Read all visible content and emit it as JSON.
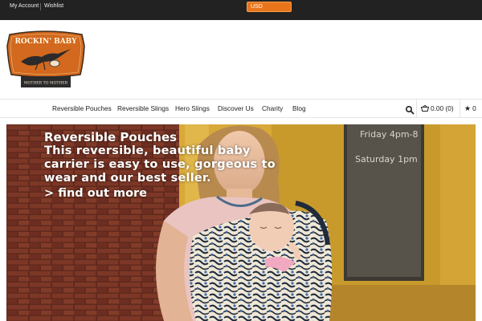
{
  "topbar": {
    "my_account": "My Account",
    "wishlist": "Wishlist",
    "currency": "USD"
  },
  "logo": {
    "text_top": "ROCKIN' BABY",
    "text_bottom": "MOTHER TO MOTHER",
    "colors": {
      "orange": "#d2691e",
      "dark": "#2b2b2b"
    }
  },
  "nav": {
    "items": [
      {
        "label": "Reversible Pouches"
      },
      {
        "label": "Reversible Slings"
      },
      {
        "label": "Hero Slings"
      },
      {
        "label": "Discover Us"
      },
      {
        "label": "Charity"
      },
      {
        "label": "Blog"
      }
    ],
    "cart_total": "0.00",
    "cart_count": "(0)",
    "wishlist_count": "0"
  },
  "hero": {
    "title": "Reversible Pouches",
    "description": "This reversible, beautiful baby carrier is easy to use, gorgeous to wear and our best seller.",
    "link": "> find out more",
    "window_text_1": "Friday 4pm-8",
    "window_text_2": "Saturday 1pm"
  },
  "colors": {
    "topbar_bg": "#222222",
    "accent": "#e8751b",
    "brick": "#8a3a2a",
    "door_yellow": "#d8a939"
  }
}
